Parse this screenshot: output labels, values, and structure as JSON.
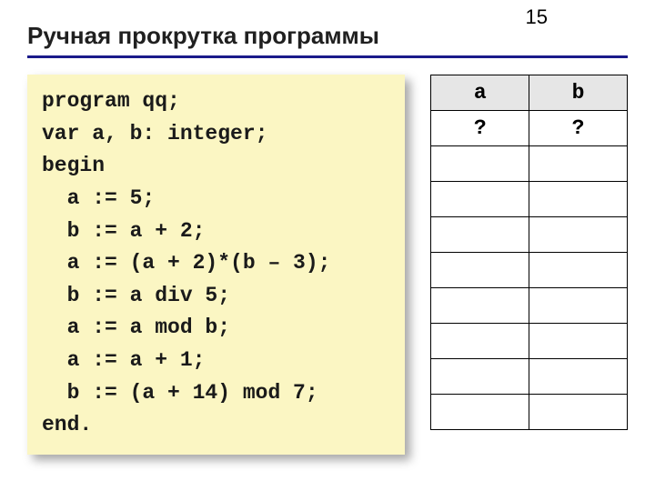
{
  "page_number": "15",
  "title": "Ручная прокрутка программы",
  "code": {
    "l0": "program qq;",
    "l1": "var a, b: integer;",
    "l2": "begin",
    "l3": "  a := 5;",
    "l4": "  b := a + 2;",
    "l5": "  a := (a + 2)*(b – 3);",
    "l6": "  b := a div 5;",
    "l7": "  a := a mod b;",
    "l8": "  a := a + 1;",
    "l9": "  b := (a + 14) mod 7;",
    "l10": "end."
  },
  "table": {
    "header_a": "a",
    "header_b": "b",
    "rows": [
      {
        "a": "?",
        "b": "?"
      },
      {
        "a": "",
        "b": ""
      },
      {
        "a": "",
        "b": ""
      },
      {
        "a": "",
        "b": ""
      },
      {
        "a": "",
        "b": ""
      },
      {
        "a": "",
        "b": ""
      },
      {
        "a": "",
        "b": ""
      },
      {
        "a": "",
        "b": ""
      },
      {
        "a": "",
        "b": ""
      }
    ]
  }
}
